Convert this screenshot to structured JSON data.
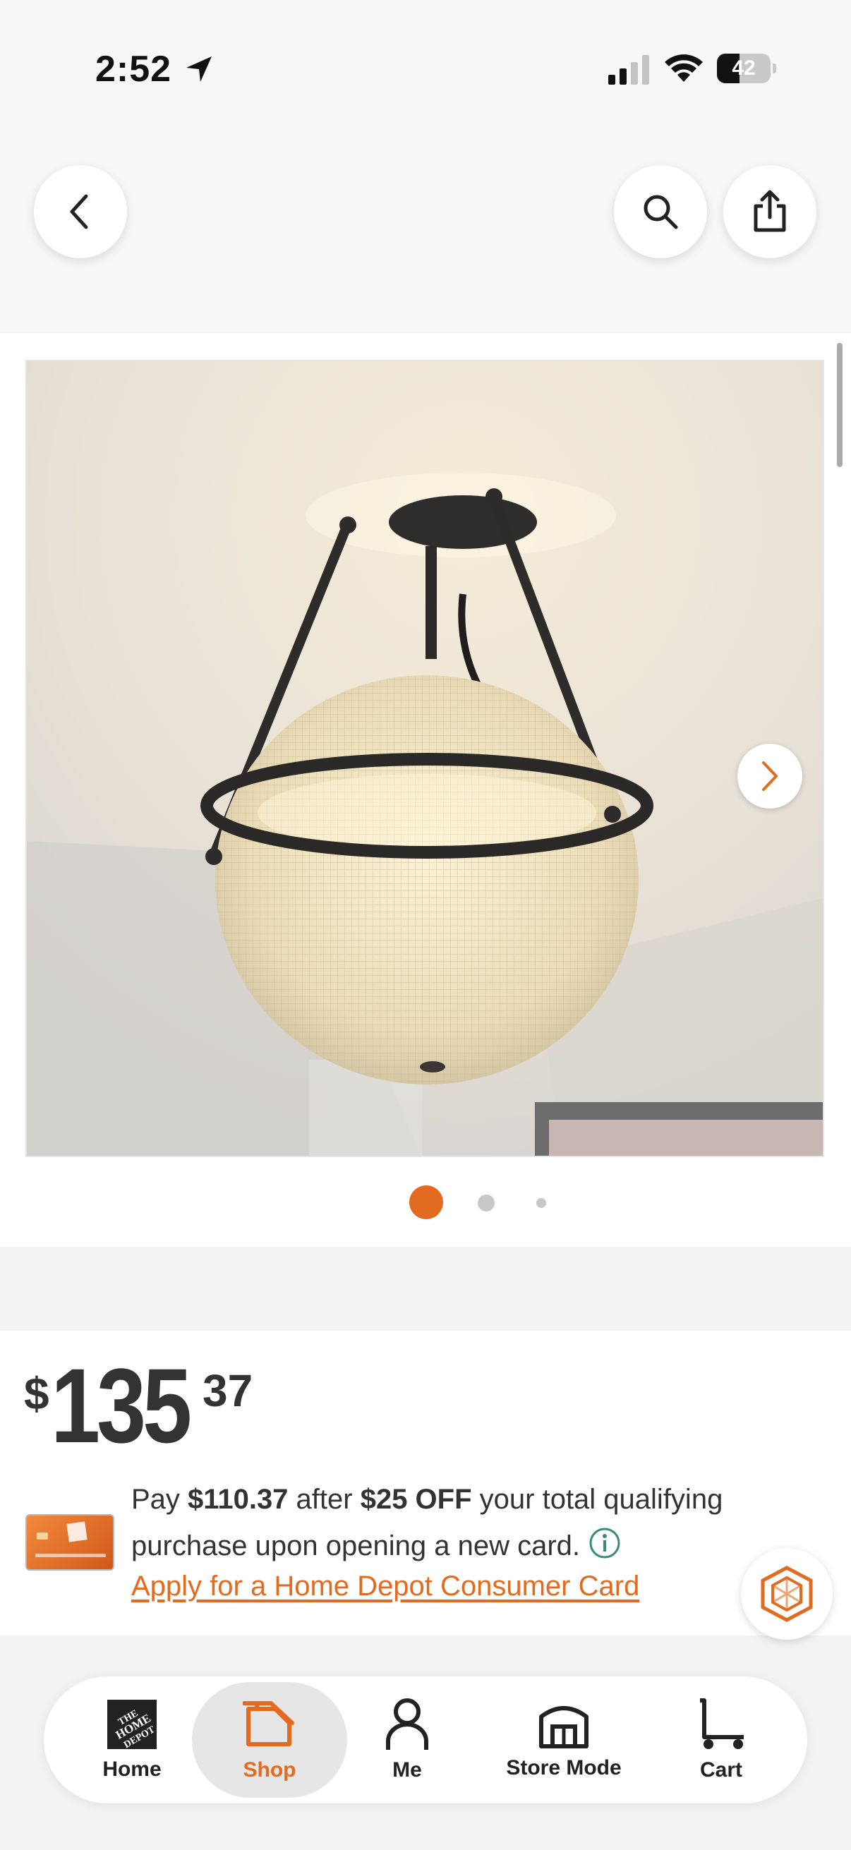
{
  "status_bar": {
    "time": "2:52",
    "battery_level": 42,
    "battery_label": "42",
    "icons": [
      "location-arrow-icon",
      "cellular-signal-icon",
      "wifi-icon",
      "battery-icon"
    ]
  },
  "top_nav": {
    "back_icon": "chevron-left-icon",
    "search_icon": "search-icon",
    "share_icon": "share-icon"
  },
  "gallery": {
    "image_description": "Ceiling light fixture with prismatic glass globe and dark bronze frame",
    "next_icon": "chevron-right-icon",
    "image_count": 3,
    "active_index": 1
  },
  "price": {
    "currency": "$",
    "whole": "135",
    "cents": "37"
  },
  "promo": {
    "pay_text": "Pay ",
    "discounted_price": "$110.37",
    "after_text": " after ",
    "discount": "$25 OFF",
    "rest_text": " your total qualifying purchase upon opening a new card.",
    "apply_link": "Apply for a Home Depot Consumer Card"
  },
  "tabs": [
    {
      "label": "Home",
      "icon": "home-depot-logo-icon",
      "active": false
    },
    {
      "label": "Shop",
      "icon": "shop-tag-icon",
      "active": true
    },
    {
      "label": "Me",
      "icon": "person-icon",
      "active": false
    },
    {
      "label": "Store Mode",
      "icon": "store-icon",
      "active": false
    },
    {
      "label": "Cart",
      "icon": "cart-icon",
      "active": false
    }
  ],
  "colors": {
    "accent": "#e36b1f",
    "text": "#333333",
    "background": "#f3f3f3"
  }
}
